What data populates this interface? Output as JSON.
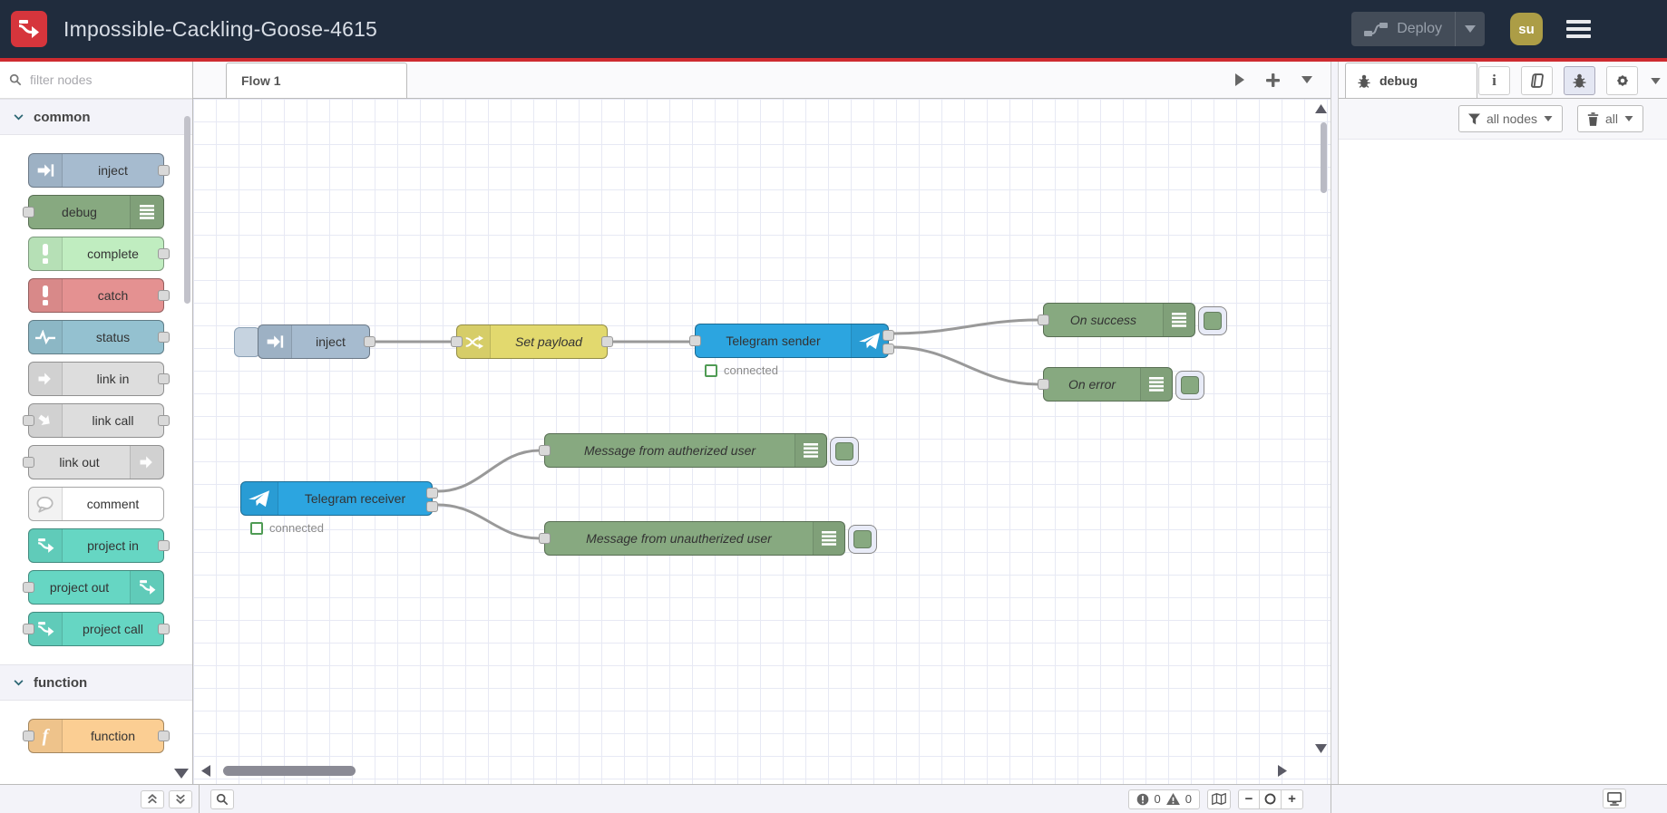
{
  "header": {
    "title": "Impossible-Cackling-Goose-4615",
    "deploy_label": "Deploy",
    "user_initials": "su"
  },
  "palette": {
    "filter_placeholder": "filter nodes",
    "categories": [
      {
        "label": "common",
        "nodes": [
          {
            "label": "inject",
            "color": "#a6bbcf"
          },
          {
            "label": "debug",
            "color": "#87a980"
          },
          {
            "label": "complete",
            "color": "#c0edc0"
          },
          {
            "label": "catch",
            "color": "#e49191"
          },
          {
            "label": "status",
            "color": "#94c1d0"
          },
          {
            "label": "link in",
            "color": "#dddddd"
          },
          {
            "label": "link call",
            "color": "#dddddd"
          },
          {
            "label": "link out",
            "color": "#dddddd"
          },
          {
            "label": "comment",
            "color": "#ffffff"
          },
          {
            "label": "project in",
            "color": "#66d6c3"
          },
          {
            "label": "project out",
            "color": "#66d6c3"
          },
          {
            "label": "project call",
            "color": "#66d6c3"
          }
        ]
      },
      {
        "label": "function",
        "nodes": [
          {
            "label": "function",
            "color": "#fbce93"
          }
        ]
      }
    ]
  },
  "workspace": {
    "tab_label": "Flow 1"
  },
  "flow": {
    "nodes": [
      {
        "label": "inject",
        "type": "inject",
        "color": "#a6bbcf"
      },
      {
        "label": "Set payload",
        "type": "change",
        "color": "#e2d96e"
      },
      {
        "label": "Telegram sender",
        "type": "telegram",
        "color": "#2ca5e0",
        "status": "connected"
      },
      {
        "label": "On success",
        "type": "debug",
        "color": "#87a980"
      },
      {
        "label": "On error",
        "type": "debug",
        "color": "#87a980"
      },
      {
        "label": "Telegram receiver",
        "type": "telegram",
        "color": "#2ca5e0",
        "status": "connected"
      },
      {
        "label": "Message from autherized user",
        "type": "debug",
        "color": "#87a980"
      },
      {
        "label": "Message from unautherized user",
        "type": "debug",
        "color": "#87a980"
      }
    ],
    "wire_color": "#999999"
  },
  "sidebar": {
    "tab_label": "debug",
    "filter_button_label": "all nodes",
    "clear_button_label": "all"
  },
  "canvas_footer": {
    "error_count": "0",
    "warning_count": "0",
    "zoom_out_glyph": "−",
    "zoom_in_glyph": "+"
  },
  "icons": {
    "info_glyph": "i",
    "function_glyph": "f"
  },
  "colors": {
    "header_bg": "#202c3d",
    "accent_red": "#ce2b30",
    "grid": "#e7e9f4"
  }
}
